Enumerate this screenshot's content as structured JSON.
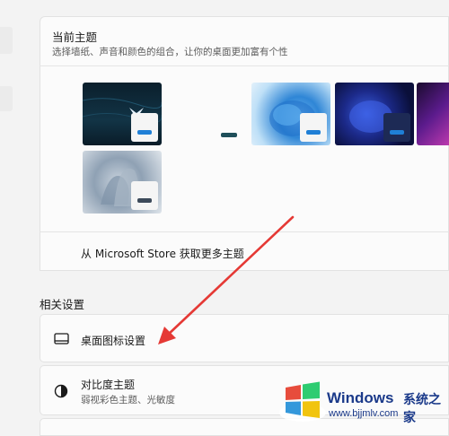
{
  "current_theme": {
    "title": "当前主题",
    "subtitle": "选择墙纸、声音和颜色的组合，让你的桌面更加富有个性"
  },
  "themes": [
    {
      "name": "dark-glow",
      "accent": "#1f7fd6"
    },
    {
      "name": "light-plain",
      "accent": "#1f4f5a"
    },
    {
      "name": "windows-light",
      "accent": "#1f7fd6"
    },
    {
      "name": "windows-dark",
      "accent": "#1f7fd6"
    },
    {
      "name": "purple-flow",
      "accent": "#7a2fb5"
    },
    {
      "name": "captured-motion",
      "accent": "#3c4a5a"
    }
  ],
  "store_link": {
    "label": "从 Microsoft Store 获取更多主题"
  },
  "related": {
    "title": "相关设置",
    "items": [
      {
        "label": "桌面图标设置",
        "icon": "monitor-icon"
      },
      {
        "label": "对比度主题",
        "sub": "弱视彩色主题、光敏度",
        "icon": "contrast-icon"
      }
    ]
  },
  "watermark": {
    "title": "Windows",
    "cn": "系统之家",
    "url": "www.bjjmlv.com"
  },
  "colors": {
    "annotation_arrow": "#e53935",
    "accent": "#1f7fd6"
  }
}
